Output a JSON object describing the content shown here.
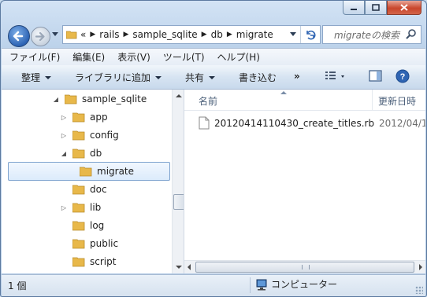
{
  "window": {
    "caption_buttons": [
      "minimize",
      "maximize",
      "close"
    ]
  },
  "address": {
    "overflow": "«",
    "path": [
      "rails",
      "sample_sqlite",
      "db",
      "migrate"
    ]
  },
  "search": {
    "placeholder": "migrateの検索"
  },
  "menu": [
    "ファイル(F)",
    "編集(E)",
    "表示(V)",
    "ツール(T)",
    "ヘルプ(H)"
  ],
  "toolbar": {
    "organize": "整理",
    "library": "ライブラリに追加",
    "share": "共有",
    "burn": "書き込む",
    "more": "»"
  },
  "tree": [
    {
      "label": "sample_sqlite",
      "expander": "expanded",
      "level": 0
    },
    {
      "label": "app",
      "expander": "collapsed",
      "level": 1
    },
    {
      "label": "config",
      "expander": "collapsed",
      "level": 1
    },
    {
      "label": "db",
      "expander": "expanded",
      "level": 1
    },
    {
      "label": "migrate",
      "expander": "none",
      "level": 2,
      "selected": true
    },
    {
      "label": "doc",
      "expander": "none",
      "level": 1
    },
    {
      "label": "lib",
      "expander": "collapsed",
      "level": 1
    },
    {
      "label": "log",
      "expander": "none",
      "level": 1
    },
    {
      "label": "public",
      "expander": "none",
      "level": 1
    },
    {
      "label": "script",
      "expander": "none",
      "level": 1
    }
  ],
  "columns": {
    "name": "名前",
    "modified": "更新日時"
  },
  "files": [
    {
      "name": "20120414110430_create_titles.rb",
      "modified": "2012/04/1"
    }
  ],
  "status": {
    "count": "1 個",
    "location": "コンピューター"
  },
  "colors": {
    "accent": "#2d64b5",
    "folder": "#e8b84a",
    "selection_border": "#7da2ce",
    "close_button": "#c9462c"
  },
  "icons": [
    "back-arrow-icon",
    "forward-arrow-icon",
    "folder-icon",
    "refresh-icon",
    "search-icon",
    "view-icon",
    "preview-pane-icon",
    "help-icon",
    "file-icon",
    "computer-icon"
  ]
}
